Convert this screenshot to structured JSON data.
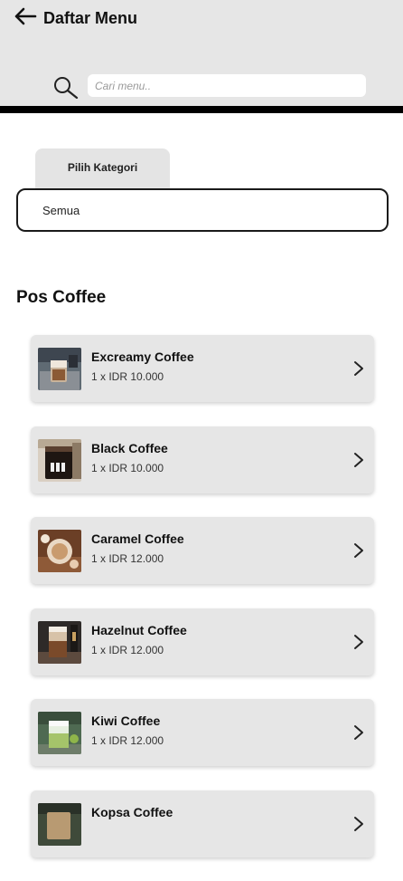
{
  "header": {
    "back_icon": "arrow-left-icon",
    "title": "Daftar Menu",
    "background": "#e6e6e6",
    "bar_color": "#000000"
  },
  "search": {
    "icon": "search-icon",
    "placeholder": "Cari menu.."
  },
  "category": {
    "tab_label": "Pilih Kategori",
    "selected": "Semua"
  },
  "section": {
    "title": "Pos Coffee"
  },
  "menu_items": [
    {
      "name": "Excreamy Coffee",
      "price": "1 x IDR 10.000",
      "chevron_icon": "chevron-right-icon"
    },
    {
      "name": "Black Coffee",
      "price": "1 x IDR 10.000",
      "chevron_icon": "chevron-right-icon"
    },
    {
      "name": "Caramel Coffee",
      "price": "1 x IDR 12.000",
      "chevron_icon": "chevron-right-icon"
    },
    {
      "name": "Hazelnut Coffee",
      "price": "1 x IDR 12.000",
      "chevron_icon": "chevron-right-icon"
    },
    {
      "name": "Kiwi Coffee",
      "price": "1 x IDR 12.000",
      "chevron_icon": "chevron-right-icon"
    },
    {
      "name": "Kopsa Coffee",
      "price": "",
      "chevron_icon": "chevron-right-icon"
    }
  ]
}
